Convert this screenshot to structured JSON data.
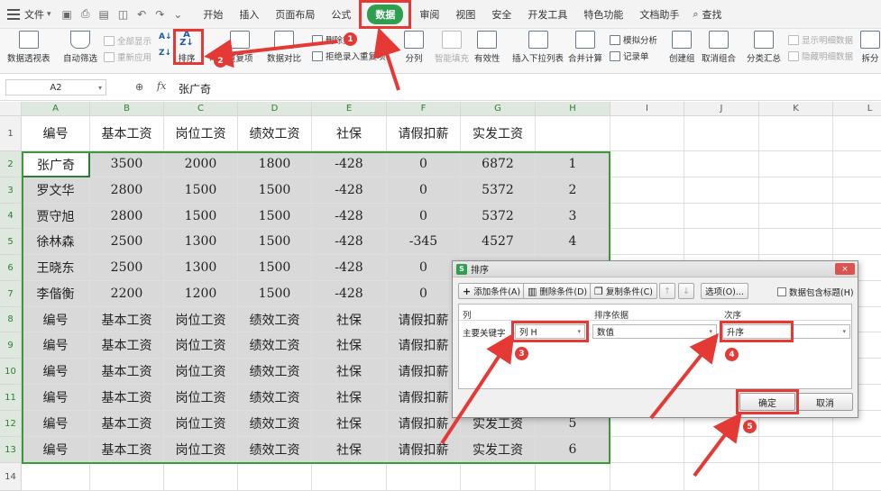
{
  "menubar": {
    "file_label": "文件",
    "tabs": [
      "开始",
      "插入",
      "页面布局",
      "公式",
      "数据",
      "审阅",
      "视图",
      "安全",
      "开发工具",
      "特色功能",
      "文档助手"
    ],
    "active_tab": "数据",
    "search_label": "查找"
  },
  "ribbon": {
    "pivot": "数据透视表",
    "autofilter": "自动筛选",
    "show_all": "全部显示",
    "reapply": "重新应用",
    "sort": "排序",
    "highlight_dup": "高",
    "dup": "重复项",
    "compare": "数据对比",
    "del_dup": "删除重",
    "del_dup_tail": "项",
    "reject_dup": "拒绝录入重复项",
    "split": "分列",
    "smart_fill": "智能填充",
    "validity": "有效性",
    "dropdown": "插入下拉列表",
    "consolidate": "合并计算",
    "simulate": "模拟分析",
    "record": "记录单",
    "group": "创建组",
    "ungroup": "取消组合",
    "subtotal": "分类汇总",
    "show_detail": "显示明细数据",
    "hide_detail": "隐藏明细数据",
    "split_table": "拆分"
  },
  "formula_bar": {
    "cell_ref": "A2",
    "fx": "fx",
    "value": "张广奇"
  },
  "columns": [
    "A",
    "B",
    "C",
    "D",
    "E",
    "F",
    "G",
    "H",
    "I",
    "J",
    "K",
    "L"
  ],
  "rows": [
    [
      "编号",
      "基本工资",
      "岗位工资",
      "绩效工资",
      "社保",
      "请假扣薪",
      "实发工资",
      ""
    ],
    [
      "张广奇",
      "3500",
      "2000",
      "1800",
      "-428",
      "0",
      "6872",
      "1"
    ],
    [
      "罗文华",
      "2800",
      "1500",
      "1500",
      "-428",
      "0",
      "5372",
      "2"
    ],
    [
      "贾守旭",
      "2800",
      "1500",
      "1500",
      "-428",
      "0",
      "5372",
      "3"
    ],
    [
      "徐林森",
      "2500",
      "1300",
      "1500",
      "-428",
      "-345",
      "4527",
      "4"
    ],
    [
      "王晓东",
      "2500",
      "1300",
      "1500",
      "-428",
      "0",
      "",
      ""
    ],
    [
      "李偕衡",
      "2200",
      "1200",
      "1500",
      "-428",
      "0",
      "",
      ""
    ],
    [
      "编号",
      "基本工资",
      "岗位工资",
      "绩效工资",
      "社保",
      "请假扣薪",
      "",
      ""
    ],
    [
      "编号",
      "基本工资",
      "岗位工资",
      "绩效工资",
      "社保",
      "请假扣薪",
      "",
      ""
    ],
    [
      "编号",
      "基本工资",
      "岗位工资",
      "绩效工资",
      "社保",
      "请假扣薪",
      "",
      ""
    ],
    [
      "编号",
      "基本工资",
      "岗位工资",
      "绩效工资",
      "社保",
      "请假扣薪",
      "",
      ""
    ],
    [
      "编号",
      "基本工资",
      "岗位工资",
      "绩效工资",
      "社保",
      "请假扣薪",
      "实发工资",
      "5"
    ],
    [
      "编号",
      "基本工资",
      "岗位工资",
      "绩效工资",
      "社保",
      "请假扣薪",
      "实发工资",
      "6"
    ],
    [
      "",
      "",
      "",
      "",
      "",
      "",
      "",
      ""
    ]
  ],
  "dialog": {
    "title": "排序",
    "close": "×",
    "add_condition": "添加条件(A)",
    "delete_condition": "删除条件(D)",
    "copy_condition": "复制条件(C)",
    "up": "↑",
    "down": "↓",
    "options": "选项(O)...",
    "header_checkbox": "数据包含标题(H)",
    "col_header": "列",
    "basis_header": "排序依据",
    "order_header": "次序",
    "primary_key_label": "主要关键字",
    "primary_key_value": "列 H",
    "basis_value": "数值",
    "order_value": "升序",
    "ok": "确定",
    "cancel": "取消"
  },
  "annotations": [
    "1",
    "2",
    "3",
    "4",
    "5"
  ],
  "colors": {
    "accent_green": "#2e9e4f",
    "annotation_red": "#e53935",
    "selection_green": "#3a9a3a",
    "cell_shade": "#d9d9d9"
  }
}
